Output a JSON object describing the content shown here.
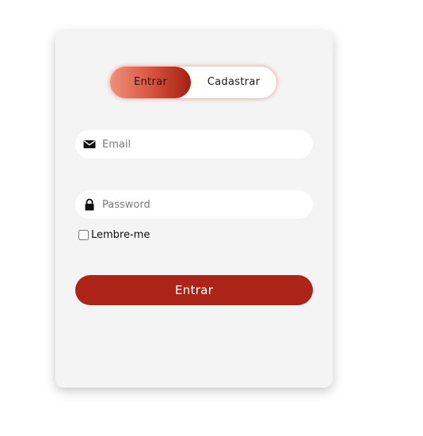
{
  "toggle": {
    "login_label": "Entrar",
    "signup_label": "Cadastrar",
    "active": "login"
  },
  "form": {
    "email": {
      "icon": "envelope-icon",
      "value": "",
      "placeholder": "Email"
    },
    "password": {
      "icon": "lock-icon",
      "value": "",
      "placeholder": "Password"
    },
    "remember": {
      "label": "Lembre-me",
      "checked": false
    },
    "submit_label": "Entrar"
  },
  "colors": {
    "card_background": "#f4f4f4",
    "accent": "#ac2417",
    "gradient_start": "#f0907a",
    "gradient_end": "#a31f12"
  }
}
